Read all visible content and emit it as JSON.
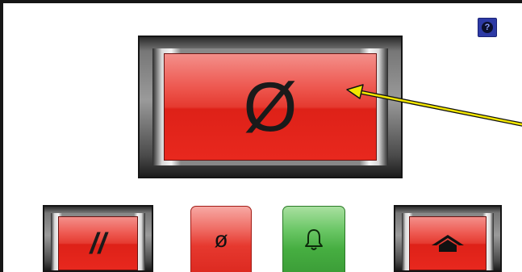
{
  "main_button": {
    "label": "Ø",
    "function": "stop"
  },
  "help_button": {
    "icon": "help-icon",
    "color": "#2d3aa5"
  },
  "bottom_bar": {
    "pause": {
      "label": "//"
    },
    "stop": {
      "label": "ø"
    },
    "alarm": {
      "icon": "bell-icon",
      "color": "#46ae41"
    },
    "home": {
      "icon": "home-icon"
    }
  },
  "annotation": {
    "type": "arrow",
    "color": "#f2e600"
  },
  "colors": {
    "red_face": "#e53a30",
    "metal_frame": "#888888",
    "border": "#161616"
  }
}
